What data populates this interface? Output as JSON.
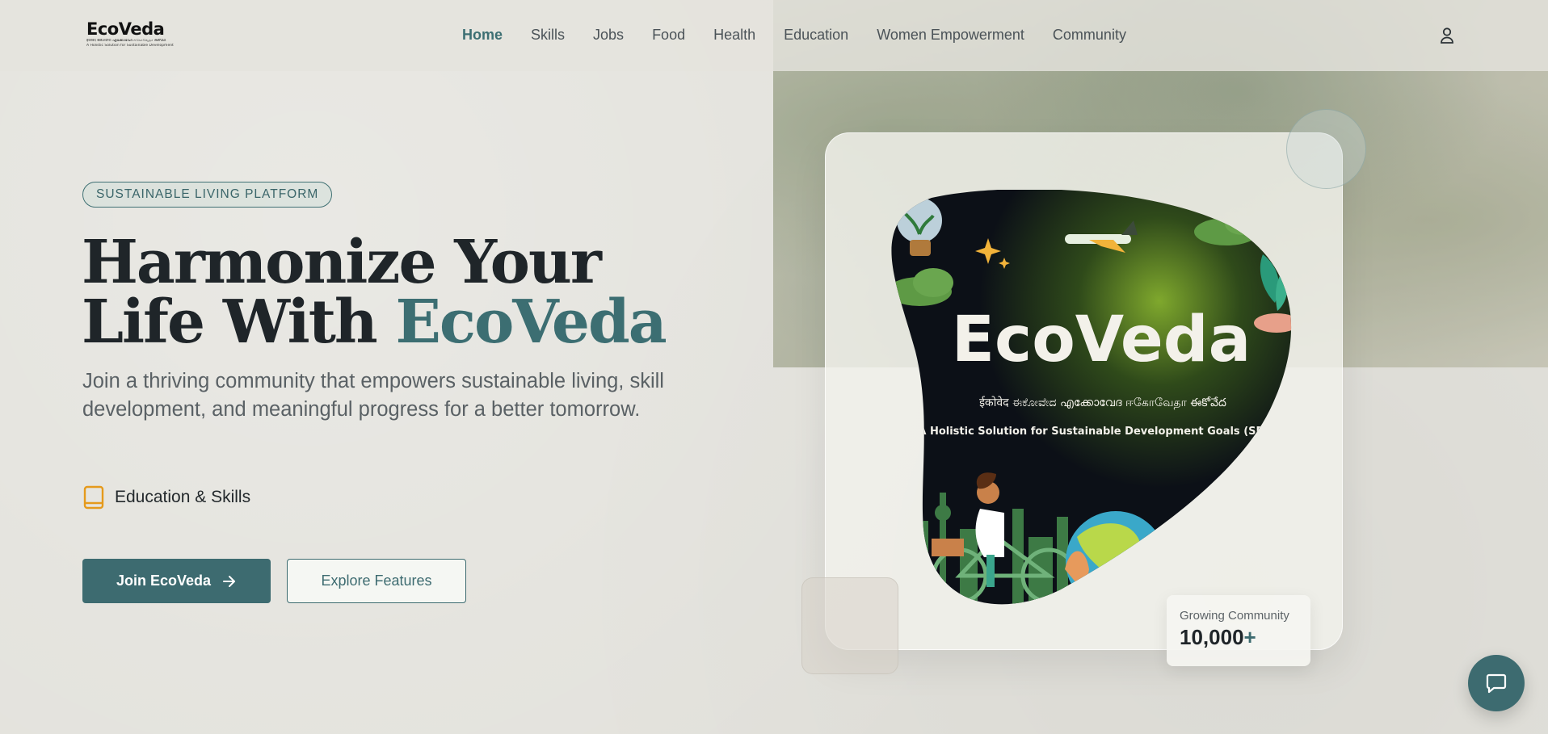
{
  "header": {
    "logo_title": "EcoVeda",
    "logo_subtitle": "ईकोवेद ಈಕೋವೇದ എക്കോവേദ ஈகோவேதா ఈకోవేద",
    "logo_tagline": "A Holistic Solution for Sustainable Development Goals (SDGs)",
    "nav": [
      {
        "label": "Home",
        "active": true
      },
      {
        "label": "Skills",
        "active": false
      },
      {
        "label": "Jobs",
        "active": false
      },
      {
        "label": "Food",
        "active": false
      },
      {
        "label": "Health",
        "active": false
      },
      {
        "label": "Education",
        "active": false
      },
      {
        "label": "Women Empowerment",
        "active": false
      },
      {
        "label": "Community",
        "active": false
      }
    ],
    "user_icon": "user-icon"
  },
  "hero": {
    "badge": "SUSTAINABLE LIVING PLATFORM",
    "title_line1": "Harmonize Your",
    "title_line2_prefix": "Life With ",
    "title_accent": "EcoVeda",
    "lead": "Join a thriving community that empowers sustainable living, skill development, and meaningful progress for a better tomorrow.",
    "feature_label": "Education & Skills",
    "feature_icon": "book-icon",
    "primary_button": "Join EcoVeda",
    "secondary_button": "Explore Features"
  },
  "card": {
    "image_title": "EcoVeda",
    "image_scripts": "ईकोवेद ಈಕೋವೇದ എക്കോവേദ ஈகோவேதா ఈకోవేద",
    "image_tagline": "A Holistic Solution for Sustainable Development Goals (SDGs)"
  },
  "stat": {
    "label": "Growing Community",
    "value": "10,000",
    "suffix": "+"
  },
  "colors": {
    "accent": "#3d6b70",
    "background": "#e2e1db",
    "text": "#1f2529",
    "feature_icon": "#e59a1c"
  },
  "chat_icon": "chat-icon"
}
